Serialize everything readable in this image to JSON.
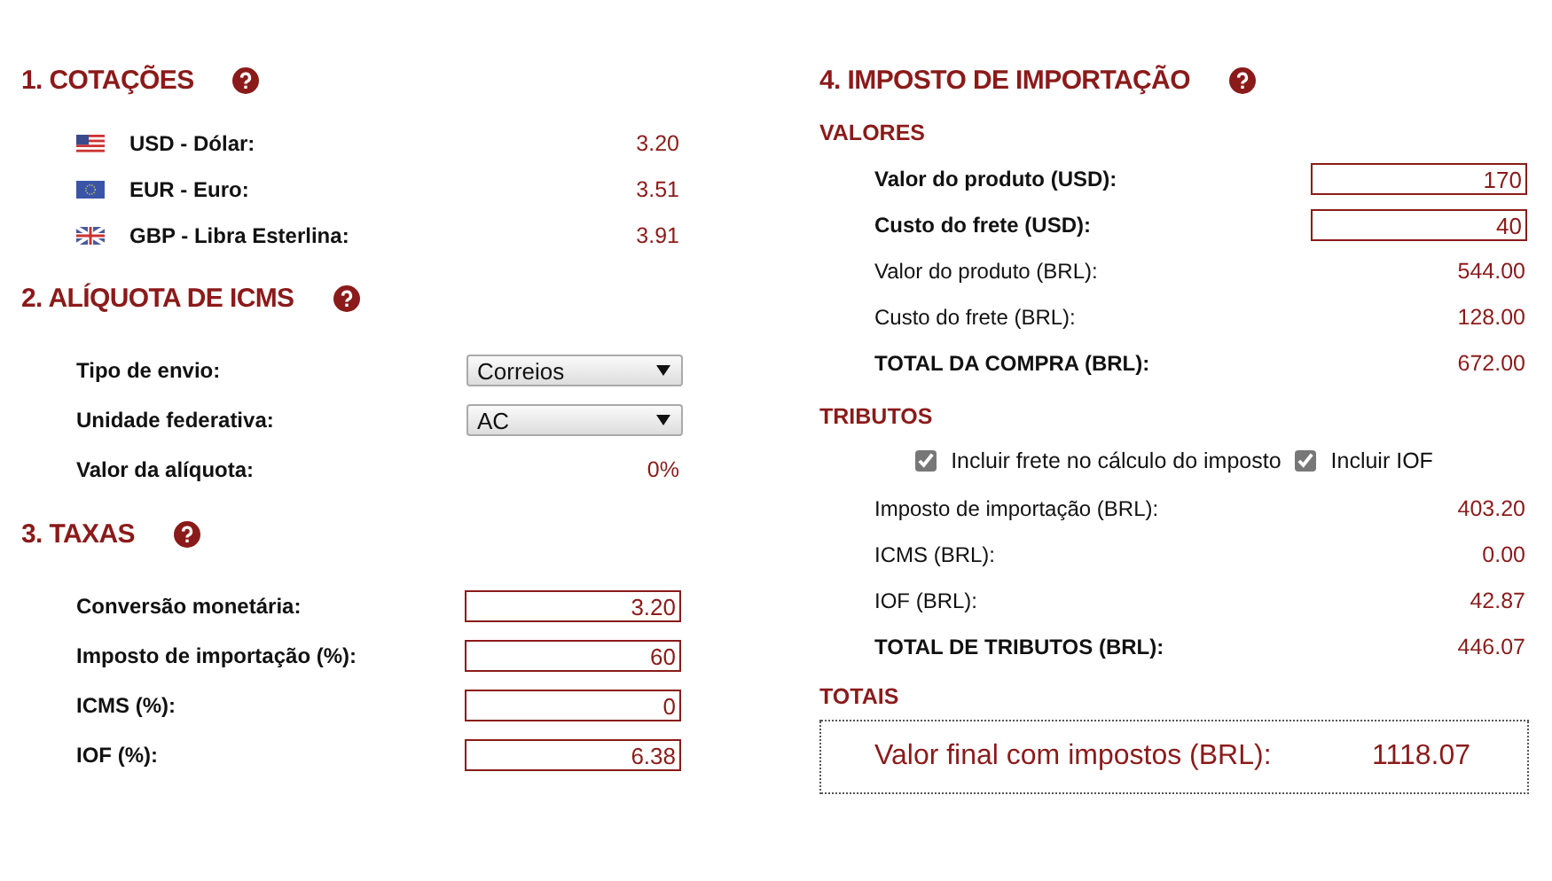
{
  "left_sections": [
    {
      "title": "1. COTAÇÕES",
      "rows": [
        {
          "kind": "rate",
          "label": "USD - Dólar:",
          "value": "3.20"
        },
        {
          "kind": "rate",
          "label": "EUR - Euro:",
          "value": "3.51"
        },
        {
          "kind": "rate",
          "label": "GBP - Libra Esterlina:",
          "value": "3.91"
        }
      ]
    },
    {
      "title": "2. ALÍQUOTA DE ICMS",
      "rows": [
        {
          "kind": "select",
          "label": "Tipo de envio:",
          "value": "Correios"
        },
        {
          "kind": "select",
          "label": "Unidade federativa:",
          "value": "AC"
        },
        {
          "kind": "text",
          "label": "Valor da alíquota:",
          "value": "0%"
        }
      ]
    },
    {
      "title": "3. TAXAS",
      "rows": [
        {
          "kind": "input",
          "label": "Conversão monetária:",
          "value": "3.20"
        },
        {
          "kind": "input",
          "label": "Imposto de importação (%):",
          "value": "60"
        },
        {
          "kind": "input",
          "label": "ICMS (%):",
          "value": "0"
        },
        {
          "kind": "input",
          "label": "IOF (%):",
          "value": "6.38"
        }
      ]
    }
  ],
  "right_section": {
    "title": "4. IMPOSTO DE IMPORTAÇÃO",
    "valores": {
      "title": "VALORES",
      "rows": [
        {
          "kind": "input",
          "bold": true,
          "label": "Valor do produto (USD):",
          "value": "170"
        },
        {
          "kind": "input",
          "bold": true,
          "label": "Custo do frete (USD):",
          "value": "40"
        },
        {
          "kind": "text",
          "bold": false,
          "label": "Valor do produto (BRL):",
          "value": "544.00"
        },
        {
          "kind": "text",
          "bold": false,
          "label": "Custo do frete (BRL):",
          "value": "128.00"
        },
        {
          "kind": "text",
          "bold": true,
          "label": "TOTAL DA COMPRA (BRL):",
          "value": "672.00"
        }
      ]
    },
    "tributos": {
      "title": "TRIBUTOS",
      "options": [
        {
          "label": "Incluir frete no cálculo do imposto",
          "checked": true
        },
        {
          "label": "Incluir IOF",
          "checked": true
        }
      ],
      "rows": [
        {
          "kind": "text",
          "bold": false,
          "label": "Imposto de importação (BRL):",
          "value": "403.20"
        },
        {
          "kind": "text",
          "bold": false,
          "label": "ICMS (BRL):",
          "value": "0.00"
        },
        {
          "kind": "text",
          "bold": false,
          "label": "IOF (BRL):",
          "value": "42.87"
        },
        {
          "kind": "text",
          "bold": true,
          "label": "TOTAL DE TRIBUTOS (BRL):",
          "value": "446.07"
        }
      ]
    },
    "totais": {
      "title": "TOTAIS",
      "label": "Valor final com impostos (BRL):",
      "value": "1118.07"
    }
  }
}
